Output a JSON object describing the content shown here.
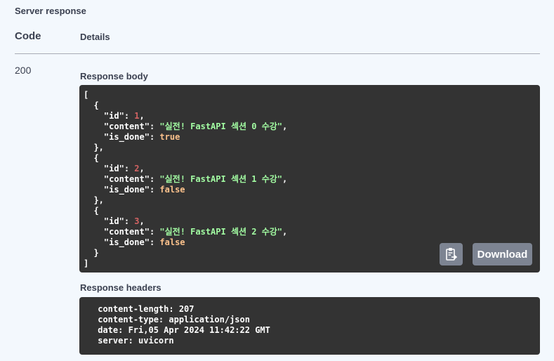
{
  "server_response": {
    "title": "Server response",
    "columns": {
      "code": "Code",
      "details": "Details"
    },
    "status_code": "200",
    "response_body": {
      "label": "Response body",
      "lines": [
        "[",
        "  {",
        "    \"id\": ",
        "1",
        "    \"content\": ",
        "\"실전! FastAPI 섹션 0 수강\"",
        "    \"is_done\": ",
        "true"
      ],
      "items": [
        {
          "id": "1",
          "content": "\"실전! FastAPI 섹션 0 수강\"",
          "is_done": "true"
        },
        {
          "id": "2",
          "content": "\"실전! FastAPI 섹션 1 수강\"",
          "is_done": "false"
        },
        {
          "id": "3",
          "content": "\"실전! FastAPI 섹션 2 수강\"",
          "is_done": "false"
        }
      ],
      "keys": {
        "id": "\"id\"",
        "content": "\"content\"",
        "is_done": "\"is_done\""
      },
      "copy_icon": "clipboard-icon",
      "download_label": "Download"
    },
    "response_headers": {
      "label": "Response headers",
      "lines": [
        " content-length: 207 ",
        " content-type: application/json ",
        " date: Fri,05 Apr 2024 11:42:22 GMT ",
        " server: uvicorn "
      ]
    }
  },
  "colors": {
    "background": "#f3f8fd",
    "code_background": "#333333",
    "number": "#d36363",
    "string": "#a2fca2",
    "boolean": "#fcc28c",
    "button": "#7d8492"
  }
}
